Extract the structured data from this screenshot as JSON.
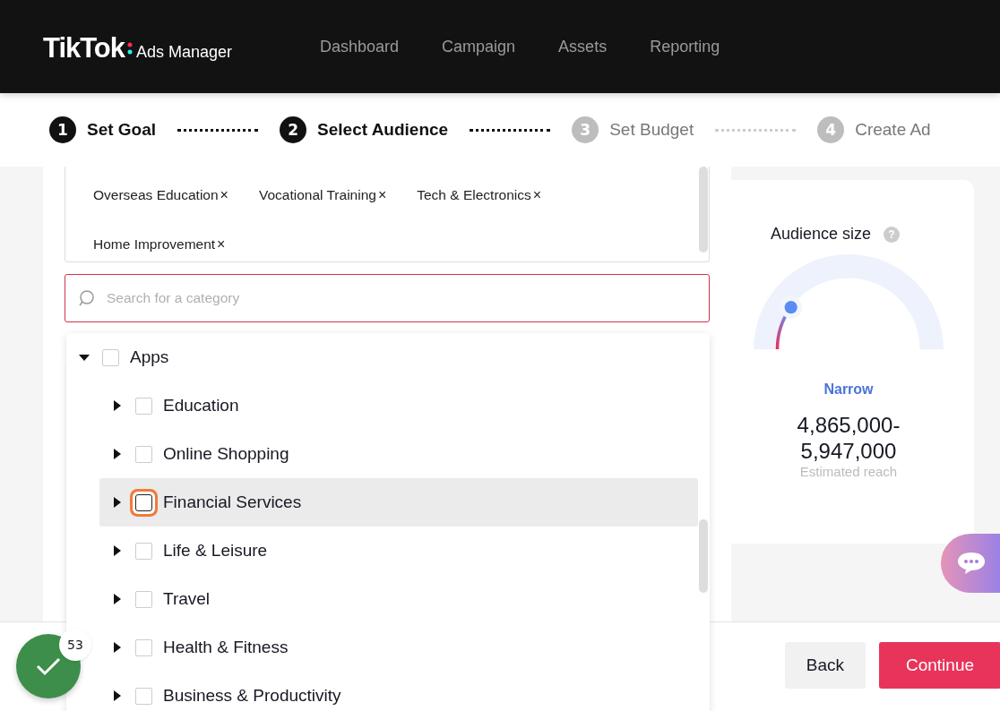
{
  "header": {
    "logo": "TikTok",
    "product": "Ads Manager",
    "nav": [
      {
        "label": "Dashboard"
      },
      {
        "label": "Campaign"
      },
      {
        "label": "Assets"
      },
      {
        "label": "Reporting"
      }
    ]
  },
  "steps": [
    {
      "number": "1",
      "label": "Set Goal",
      "reached": true
    },
    {
      "number": "2",
      "label": "Select Audience",
      "reached": true
    },
    {
      "number": "3",
      "label": "Set Budget",
      "reached": false
    },
    {
      "number": "4",
      "label": "Create Ad",
      "reached": false
    }
  ],
  "selected_tags": [
    {
      "label": "Overseas Education",
      "remove": "×"
    },
    {
      "label": "Vocational Training",
      "remove": "×"
    },
    {
      "label": "Tech & Electronics",
      "remove": "×"
    },
    {
      "label": "Home Improvement",
      "remove": "×"
    }
  ],
  "search": {
    "placeholder": "Search for a category"
  },
  "category_tree": [
    {
      "label": "Apps",
      "expanded": true,
      "checked": false,
      "focused": false,
      "children": [
        {
          "label": "Education",
          "expanded": false,
          "checked": false,
          "focused": false
        },
        {
          "label": "Online Shopping",
          "expanded": false,
          "checked": false,
          "focused": false
        },
        {
          "label": "Financial Services",
          "expanded": false,
          "checked": false,
          "focused": true
        },
        {
          "label": "Life & Leisure",
          "expanded": false,
          "checked": false,
          "focused": false
        },
        {
          "label": "Travel",
          "expanded": false,
          "checked": false,
          "focused": false
        },
        {
          "label": "Health & Fitness",
          "expanded": false,
          "checked": false,
          "focused": false
        },
        {
          "label": "Business & Productivity",
          "expanded": false,
          "checked": false,
          "focused": false
        }
      ]
    }
  ],
  "audience": {
    "title": "Audience size",
    "help": "?",
    "level": 0.2,
    "rating": "Narrow",
    "range": "4,865,000-\n5,947,000",
    "caption": "Estimated reach"
  },
  "progress_badge": {
    "count": "53"
  },
  "buttons": [
    {
      "label": "Back",
      "kind": "secondary"
    },
    {
      "label": "Continue",
      "kind": "primary"
    }
  ]
}
